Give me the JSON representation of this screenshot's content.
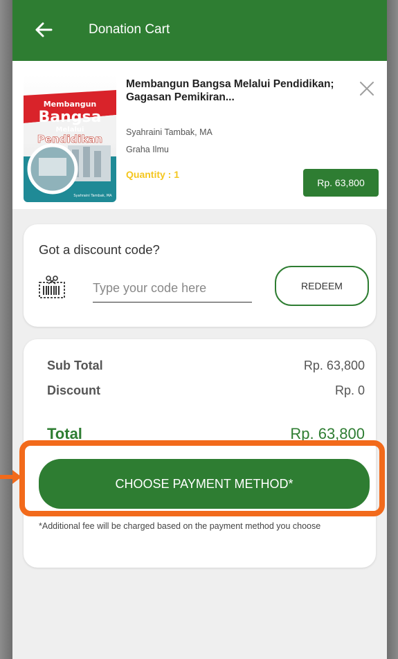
{
  "appbar": {
    "title": "Donation Cart",
    "back_icon": "arrow-left-icon"
  },
  "cart_item": {
    "title": "Membangun Bangsa Melalui Pendidikan; Gagasan Pemikiran...",
    "author": "Syahraini Tambak, MA",
    "publisher": "Graha Ilmu",
    "quantity": "Quantity : 1",
    "price": "Rp. 63,800",
    "cover": {
      "lines": [
        "Membangun",
        "Bangsa",
        "Melalui",
        "Pendidikan"
      ],
      "author": "Syahraini Tambak, MA"
    }
  },
  "discount": {
    "question": "Got a discount code?",
    "input_placeholder": "Type your code here",
    "redeem_label": "REDEEM"
  },
  "summary": {
    "subtotal_label": "Sub Total",
    "subtotal_value": "Rp. 63,800",
    "discount_label": "Discount",
    "discount_value": "Rp. 0",
    "total_label": "Total",
    "total_value": "Rp. 63,800",
    "pay_button_label": "CHOOSE PAYMENT METHOD*",
    "fee_note": "*Additional fee will be charged based on the payment method you choose"
  },
  "colors": {
    "primary_green": "#2e7d32",
    "quantity_yellow": "#f4c61f",
    "highlight_orange": "#f26a1b"
  }
}
